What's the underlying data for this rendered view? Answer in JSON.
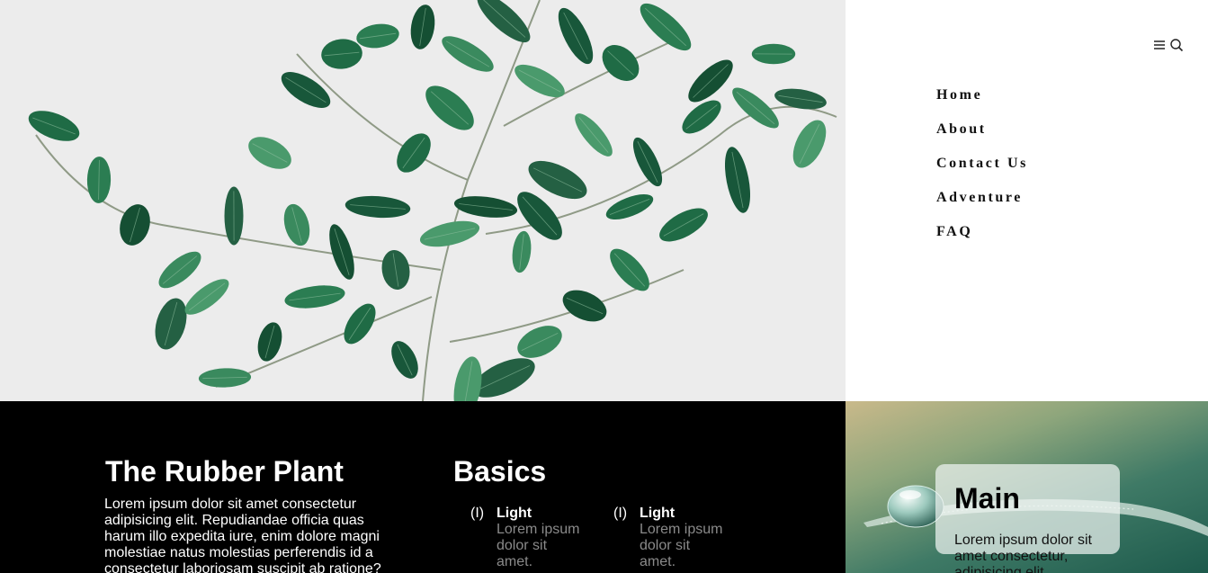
{
  "nav": {
    "items": [
      {
        "label": "Home"
      },
      {
        "label": "About"
      },
      {
        "label": "Contact Us"
      },
      {
        "label": "Adventure"
      },
      {
        "label": "FAQ"
      }
    ],
    "icons": [
      "menu-icon",
      "search-icon"
    ]
  },
  "hero": {
    "image": "green-leafy-plant-branch",
    "background_color": "#ececec"
  },
  "rubber": {
    "title": "The Rubber Plant",
    "text": "Lorem ipsum dolor sit amet consectetur adipisicing elit. Repudiandae officia quas harum illo expedita iure, enim dolore magni molestiae natus molestias perferendis id a consectetur laboriosam suscipit ab ratione?"
  },
  "basics": {
    "title": "Basics",
    "items": [
      {
        "num": "(I)",
        "name": "Light",
        "text": "Lorem ipsum dolor sit amet."
      },
      {
        "num": "(I)",
        "name": "Light",
        "text": "Lorem ipsum dolor sit amet."
      }
    ]
  },
  "main_card": {
    "title": "Main",
    "text": "Lorem ipsum dolor sit amet consectetur, adipisicing elit."
  },
  "colors": {
    "dark_band": "#000000",
    "leaf_green": "#1f6b45",
    "muted_text": "#8a8a8a"
  }
}
